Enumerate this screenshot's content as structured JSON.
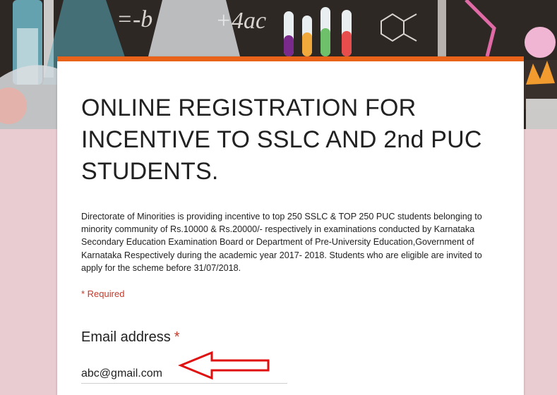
{
  "banner": {
    "chalk_text_1": "=-b",
    "chalk_text_2": "+4ac"
  },
  "form": {
    "accent_color": "#e8621a",
    "title": "ONLINE REGISTRATION FOR INCENTIVE TO SSLC AND 2nd PUC STUDENTS.",
    "description": "Directorate of Minorities is providing incentive to top 250 SSLC & TOP 250 PUC students belonging to minority community of Rs.10000 & Rs.20000/- respectively in examinations conducted by Karnataka Secondary Education Examination Board or Department of Pre-University Education,Government of Karnataka Respectively during the academic year 2017- 2018. Students who are eligible are invited to apply for the scheme before 31/07/2018.",
    "required_note": "* Required",
    "required_color": "#c5392b",
    "question": {
      "label": "Email address",
      "required_star": "*",
      "value": "abc@gmail.com"
    }
  },
  "annotation": {
    "arrow_color": "#e01010",
    "arrow_icon": "left-arrow-outline"
  }
}
